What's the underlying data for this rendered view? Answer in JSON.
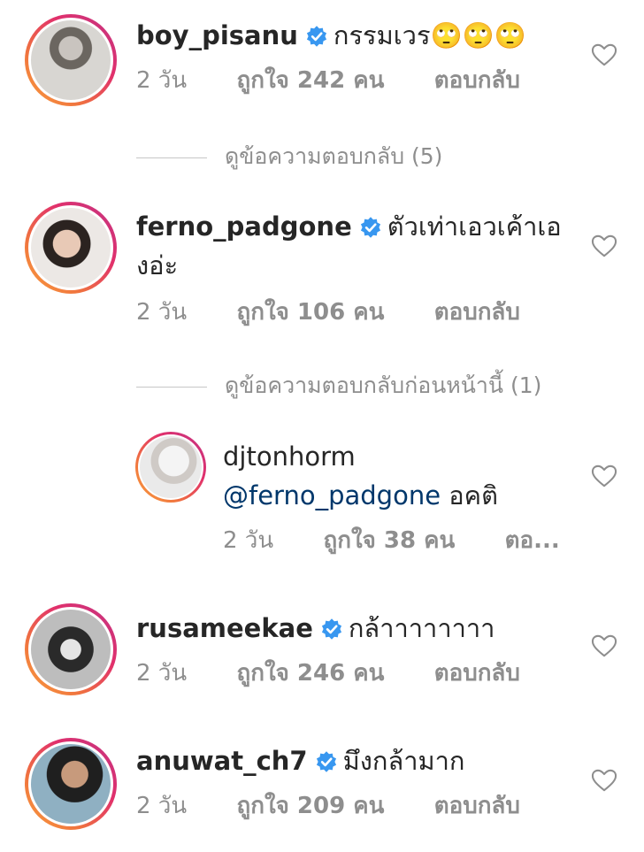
{
  "comments": [
    {
      "username": "boy_pisanu",
      "verified": true,
      "text": "กรรมเวร🙄🙄🙄",
      "time": "2 วัน",
      "likes": "ถูกใจ 242 คน",
      "reply": "ตอบกลับ"
    },
    {
      "username": "ferno_padgone",
      "verified": true,
      "text": "ตัวเท่าเอวเค้าเอ",
      "text2": "งอ่ะ",
      "time": "2 วัน",
      "likes": "ถูกใจ 106 คน",
      "reply": "ตอบกลับ"
    },
    {
      "username": "rusameekae",
      "verified": true,
      "text": "กล้าาาาาาาา",
      "time": "2 วัน",
      "likes": "ถูกใจ 246 คน",
      "reply": "ตอบกลับ"
    },
    {
      "username": "anuwat_ch7",
      "verified": true,
      "text": "มึงกล้ามาก",
      "time": "2 วัน",
      "likes": "ถูกใจ 209 คน",
      "reply": "ตอบกลับ"
    }
  ],
  "view_replies_1": "ดูข้อความตอบกลับ (5)",
  "view_replies_2": "ดูข้อความตอบกลับก่อนหน้านี้ (1)",
  "reply": {
    "username": "djtonhorm",
    "mention": "@ferno_padgone",
    "text": " อคติ",
    "time": "2 วัน",
    "likes": "ถูกใจ 38 คน",
    "reply": "ตอ..."
  },
  "colors": {
    "text": "#262626",
    "muted": "#8e8e8e",
    "mention": "#00376b",
    "verified": "#3897f0"
  },
  "icons": {
    "verified": "verified-badge-icon",
    "like": "heart-outline-icon"
  }
}
